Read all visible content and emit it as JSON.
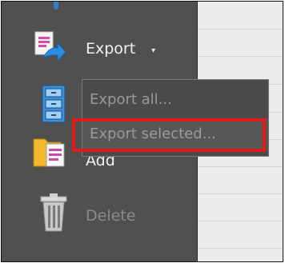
{
  "sidebar": {
    "export_label": "Export",
    "export_caret": "▾",
    "add_label": "Add",
    "delete_label": "Delete"
  },
  "export_menu": {
    "items": [
      {
        "label": "Export all..."
      },
      {
        "label": "Export selected..."
      }
    ]
  },
  "colors": {
    "sidebar_bg": "#505050",
    "menu_bg": "#4a4a4a",
    "highlight": "#e11a1a",
    "content_bg": "#ececec"
  },
  "icons": [
    "export-icon",
    "cabinet-icon",
    "add-folder-icon",
    "trash-icon"
  ]
}
